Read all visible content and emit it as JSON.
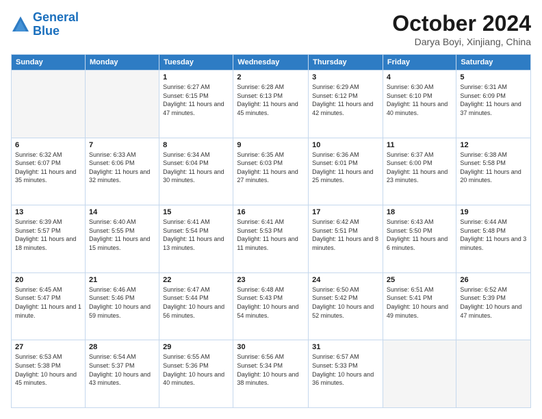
{
  "logo": {
    "line1": "General",
    "line2": "Blue"
  },
  "title": "October 2024",
  "location": "Darya Boyi, Xinjiang, China",
  "weekdays": [
    "Sunday",
    "Monday",
    "Tuesday",
    "Wednesday",
    "Thursday",
    "Friday",
    "Saturday"
  ],
  "weeks": [
    [
      {
        "day": "",
        "detail": ""
      },
      {
        "day": "",
        "detail": ""
      },
      {
        "day": "1",
        "detail": "Sunrise: 6:27 AM\nSunset: 6:15 PM\nDaylight: 11 hours and 47 minutes."
      },
      {
        "day": "2",
        "detail": "Sunrise: 6:28 AM\nSunset: 6:13 PM\nDaylight: 11 hours and 45 minutes."
      },
      {
        "day": "3",
        "detail": "Sunrise: 6:29 AM\nSunset: 6:12 PM\nDaylight: 11 hours and 42 minutes."
      },
      {
        "day": "4",
        "detail": "Sunrise: 6:30 AM\nSunset: 6:10 PM\nDaylight: 11 hours and 40 minutes."
      },
      {
        "day": "5",
        "detail": "Sunrise: 6:31 AM\nSunset: 6:09 PM\nDaylight: 11 hours and 37 minutes."
      }
    ],
    [
      {
        "day": "6",
        "detail": "Sunrise: 6:32 AM\nSunset: 6:07 PM\nDaylight: 11 hours and 35 minutes."
      },
      {
        "day": "7",
        "detail": "Sunrise: 6:33 AM\nSunset: 6:06 PM\nDaylight: 11 hours and 32 minutes."
      },
      {
        "day": "8",
        "detail": "Sunrise: 6:34 AM\nSunset: 6:04 PM\nDaylight: 11 hours and 30 minutes."
      },
      {
        "day": "9",
        "detail": "Sunrise: 6:35 AM\nSunset: 6:03 PM\nDaylight: 11 hours and 27 minutes."
      },
      {
        "day": "10",
        "detail": "Sunrise: 6:36 AM\nSunset: 6:01 PM\nDaylight: 11 hours and 25 minutes."
      },
      {
        "day": "11",
        "detail": "Sunrise: 6:37 AM\nSunset: 6:00 PM\nDaylight: 11 hours and 23 minutes."
      },
      {
        "day": "12",
        "detail": "Sunrise: 6:38 AM\nSunset: 5:58 PM\nDaylight: 11 hours and 20 minutes."
      }
    ],
    [
      {
        "day": "13",
        "detail": "Sunrise: 6:39 AM\nSunset: 5:57 PM\nDaylight: 11 hours and 18 minutes."
      },
      {
        "day": "14",
        "detail": "Sunrise: 6:40 AM\nSunset: 5:55 PM\nDaylight: 11 hours and 15 minutes."
      },
      {
        "day": "15",
        "detail": "Sunrise: 6:41 AM\nSunset: 5:54 PM\nDaylight: 11 hours and 13 minutes."
      },
      {
        "day": "16",
        "detail": "Sunrise: 6:41 AM\nSunset: 5:53 PM\nDaylight: 11 hours and 11 minutes."
      },
      {
        "day": "17",
        "detail": "Sunrise: 6:42 AM\nSunset: 5:51 PM\nDaylight: 11 hours and 8 minutes."
      },
      {
        "day": "18",
        "detail": "Sunrise: 6:43 AM\nSunset: 5:50 PM\nDaylight: 11 hours and 6 minutes."
      },
      {
        "day": "19",
        "detail": "Sunrise: 6:44 AM\nSunset: 5:48 PM\nDaylight: 11 hours and 3 minutes."
      }
    ],
    [
      {
        "day": "20",
        "detail": "Sunrise: 6:45 AM\nSunset: 5:47 PM\nDaylight: 11 hours and 1 minute."
      },
      {
        "day": "21",
        "detail": "Sunrise: 6:46 AM\nSunset: 5:46 PM\nDaylight: 10 hours and 59 minutes."
      },
      {
        "day": "22",
        "detail": "Sunrise: 6:47 AM\nSunset: 5:44 PM\nDaylight: 10 hours and 56 minutes."
      },
      {
        "day": "23",
        "detail": "Sunrise: 6:48 AM\nSunset: 5:43 PM\nDaylight: 10 hours and 54 minutes."
      },
      {
        "day": "24",
        "detail": "Sunrise: 6:50 AM\nSunset: 5:42 PM\nDaylight: 10 hours and 52 minutes."
      },
      {
        "day": "25",
        "detail": "Sunrise: 6:51 AM\nSunset: 5:41 PM\nDaylight: 10 hours and 49 minutes."
      },
      {
        "day": "26",
        "detail": "Sunrise: 6:52 AM\nSunset: 5:39 PM\nDaylight: 10 hours and 47 minutes."
      }
    ],
    [
      {
        "day": "27",
        "detail": "Sunrise: 6:53 AM\nSunset: 5:38 PM\nDaylight: 10 hours and 45 minutes."
      },
      {
        "day": "28",
        "detail": "Sunrise: 6:54 AM\nSunset: 5:37 PM\nDaylight: 10 hours and 43 minutes."
      },
      {
        "day": "29",
        "detail": "Sunrise: 6:55 AM\nSunset: 5:36 PM\nDaylight: 10 hours and 40 minutes."
      },
      {
        "day": "30",
        "detail": "Sunrise: 6:56 AM\nSunset: 5:34 PM\nDaylight: 10 hours and 38 minutes."
      },
      {
        "day": "31",
        "detail": "Sunrise: 6:57 AM\nSunset: 5:33 PM\nDaylight: 10 hours and 36 minutes."
      },
      {
        "day": "",
        "detail": ""
      },
      {
        "day": "",
        "detail": ""
      }
    ]
  ]
}
